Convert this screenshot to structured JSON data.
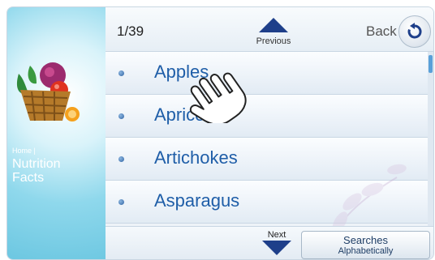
{
  "sidebar": {
    "breadcrumb": "Home |",
    "section_title": "Nutrition Facts"
  },
  "header": {
    "counter": "1/39",
    "previous_label": "Previous",
    "back_label": "Back"
  },
  "list": {
    "items": [
      {
        "label": "Apples"
      },
      {
        "label": "Apricots"
      },
      {
        "label": "Artichokes"
      },
      {
        "label": "Asparagus"
      }
    ]
  },
  "footer": {
    "next_label": "Next",
    "search_line1": "Searches",
    "search_line2": "Alphabetically"
  },
  "icons": {
    "previous": "triangle-up-icon",
    "next": "triangle-down-icon",
    "back": "refresh-back-icon",
    "bullet": "bullet-icon",
    "cursor": "hand-pointer-icon",
    "logo": "fruit-basket-icon"
  },
  "colors": {
    "accent_blue": "#1f5ea8",
    "sidebar_blue": "#6cc7e1",
    "arrow_navy": "#1e3f8a"
  }
}
